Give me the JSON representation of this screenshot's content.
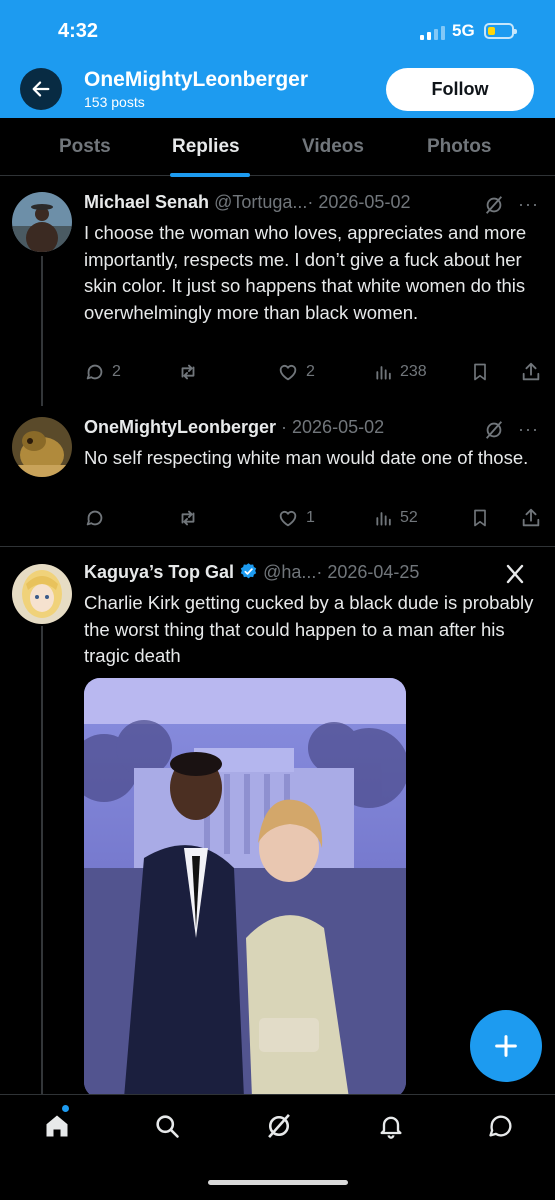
{
  "status_bar": {
    "time": "4:32",
    "network": "5G"
  },
  "header": {
    "back_icon": "arrow-left-icon",
    "profile_name": "OneMightyLeonberger",
    "post_count": "153 posts",
    "follow_label": "Follow"
  },
  "tabs": [
    {
      "label": "Posts"
    },
    {
      "label": "Replies",
      "active": true
    },
    {
      "label": "Videos"
    },
    {
      "label": "Photos"
    }
  ],
  "posts": [
    {
      "author": "Michael Senah",
      "handle": "@Tortuga...",
      "date": "· 2026-05-02",
      "text": "I choose the woman who loves, appreciates and more importantly, respects me. I don’t give a fuck about her skin color. It just so happens that white women do this overwhelmingly more than black women.",
      "replies": "2",
      "reposts": "",
      "likes": "2",
      "views": "238"
    },
    {
      "author": "OneMightyLeonberger",
      "handle": "",
      "date": "· 2026-05-02",
      "text": "No self respecting white man would date one of those.",
      "replies": "",
      "reposts": "",
      "likes": "1",
      "views": "52"
    },
    {
      "author": "Kaguya’s Top Gal",
      "handle": "@ha...",
      "date": "· 2026-04-25",
      "text": "Charlie Kirk getting cucked by a black dude is probably the worst thing that could happen to a man after his tragic death",
      "verified": true
    }
  ],
  "colors": {
    "accent": "#1d9bf0",
    "background": "#000000",
    "muted": "#71767b",
    "text": "#e7e9ea"
  },
  "icons": {
    "post_actions": [
      "reply-icon",
      "repost-icon",
      "like-icon",
      "views-icon",
      "bookmark-icon",
      "share-icon"
    ],
    "fab": "plus-icon",
    "nav": [
      "home-icon",
      "search-icon",
      "grok-icon",
      "notifications-icon",
      "messages-icon"
    ]
  }
}
